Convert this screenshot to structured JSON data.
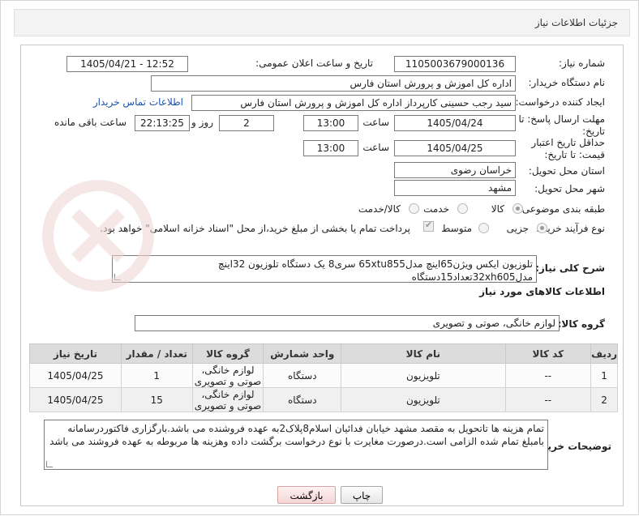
{
  "header": {
    "title": "جزئیات اطلاعات نیاز"
  },
  "need_number": {
    "label": "شماره نیاز:",
    "value": "1105003679000136"
  },
  "announce_datetime": {
    "label": "تاریخ و ساعت اعلان عمومی:",
    "value": "1405/04/21 - 12:52"
  },
  "buyer_org": {
    "label": "نام دستگاه خریدار:",
    "value": "اداره کل اموزش و پرورش استان فارس"
  },
  "requester": {
    "label": "ایجاد کننده درخواست:",
    "value": "سید رجب حسینی کارپرداز اداره کل اموزش و پرورش استان فارس",
    "contact_link": "اطلاعات تماس خریدار"
  },
  "reply_deadline": {
    "label": "مهلت ارسال پاسخ: تا تاریخ:",
    "date": "1405/04/24",
    "time_label": "ساعت",
    "time": "13:00",
    "days": "2",
    "days_label": "روز و",
    "remaining": "22:13:25",
    "remaining_label": "ساعت باقی مانده"
  },
  "price_validity": {
    "label": "حداقل تاریخ اعتبار قیمت: تا تاریخ:",
    "date": "1405/04/25",
    "time_label": "ساعت",
    "time": "13:00"
  },
  "delivery_province": {
    "label": "استان محل تحویل:",
    "value": "خراسان رضوی"
  },
  "delivery_city": {
    "label": "شهر محل تحویل:",
    "value": "مشهد"
  },
  "category": {
    "label": "طبقه بندی موضوعی:",
    "options": [
      "کالا",
      "خدمت",
      "کالا/خدمت"
    ],
    "selected": "کالا"
  },
  "purchase_type": {
    "label": "نوع فرآیند خرید :",
    "options": [
      "جزیی",
      "متوسط"
    ],
    "selected": "جزیی",
    "note": "پرداخت تمام یا بخشی از مبلغ خرید،از محل \"اسناد خزانه اسلامی\" خواهد بود."
  },
  "need_description": {
    "label": "شرح کلی نیاز:",
    "value": "تلوزیون ایکس ویژن65اینچ  مدل65xtu855 سری8 یک دستگاه تلوزیون 32اینچ مدل32xh605تعداد15دستگاه"
  },
  "goods_info_title": "اطلاعات کالاهای مورد نیاز",
  "goods_group": {
    "label": "گروه کالا:",
    "value": "لوازم خانگی، صوتی و تصویری"
  },
  "table": {
    "headers": [
      "ردیف",
      "کد کالا",
      "نام کالا",
      "واحد شمارش",
      "گروه کالا",
      "تعداد / مقدار",
      "تاریخ نیاز"
    ],
    "rows": [
      [
        "1",
        "--",
        "تلویزیون",
        "دستگاه",
        "لوازم خانگی، صوتی و تصویری",
        "1",
        "1405/04/25"
      ],
      [
        "2",
        "--",
        "تلویزیون",
        "دستگاه",
        "لوازم خانگی، صوتی و تصویری",
        "15",
        "1405/04/25"
      ]
    ]
  },
  "buyer_notes": {
    "label": "توضیحات خریدار:",
    "value": "تمام هزینه ها تاتحویل به مقصد مشهد خیابان فدائیان اسلام8پلاک2به عهده فروشنده می باشد.بارگزاری فاکتوردرسامانه بامبلغ تمام شده الزامی است.درصورت مغایرت با نوع درخواست برگشت داده وهزینه ها مربوطه به عهده فروشند می باشد"
  },
  "buttons": {
    "print": "چاپ",
    "back": "بازگشت"
  },
  "colors": {
    "link": "#1a55b0",
    "header_bg": "#f3f3f3",
    "table_header_bg": "#dcdcdc",
    "watermark": "#f2dede"
  }
}
